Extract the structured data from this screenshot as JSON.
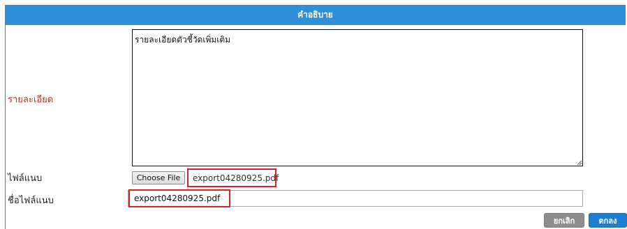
{
  "header": {
    "title": "คำอธิบาย"
  },
  "form": {
    "detail_label": "รายละเอียด",
    "detail_value": "รายละเอียดตัวชี้วัดเพิ่มเติม",
    "attachment_label": "ไฟล์แนบ",
    "choose_file_label": "Choose File",
    "selected_file_name": "export04280925.pdf",
    "attachment_name_label": "ชื่อไฟล์แนบ",
    "attachment_name_value": "export04280925.pdf"
  },
  "actions": {
    "cancel_label": "ยกเลิก",
    "ok_label": "ตกลง"
  },
  "colors": {
    "header_bg": "#2f8fd8",
    "required_label": "#b03434",
    "highlight_box": "#e02020",
    "cancel_bg": "#8e8e8e",
    "ok_bg": "#1f7ed0"
  }
}
